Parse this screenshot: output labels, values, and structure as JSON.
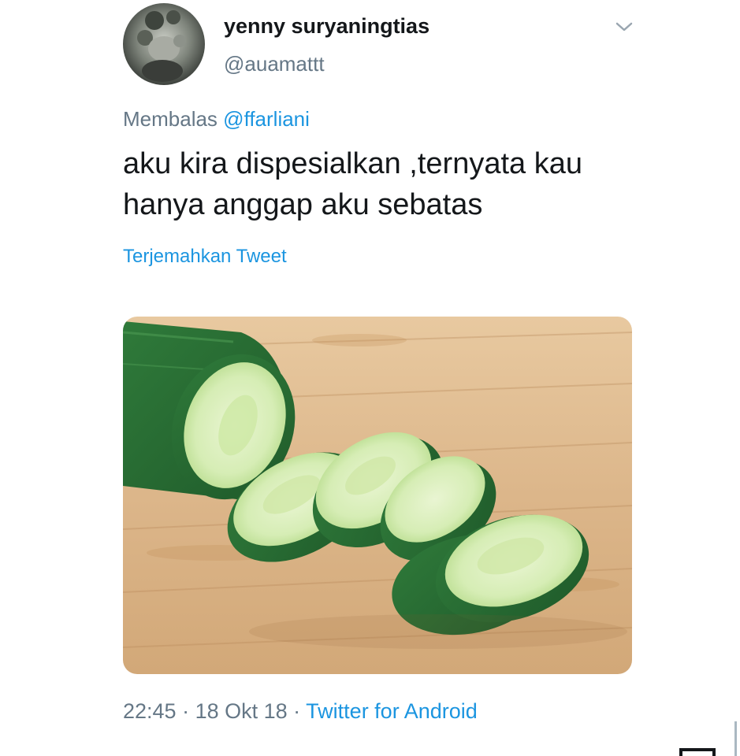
{
  "tweet": {
    "author": {
      "display_name": "yenny suryaningtias",
      "handle": "@auamattt",
      "avatar_icon": "profile-photo"
    },
    "reply": {
      "prefix": "Membalas",
      "mention": "@ffarliani"
    },
    "text": "aku kira dispesialkan ,ternyata kau hanya anggap aku sebatas",
    "translate_label": "Terjemahkan Tweet",
    "media": {
      "description_icon": "cucumber-slices-photo"
    },
    "meta": {
      "time": "22:45",
      "separator_1": " · ",
      "date": "18 Okt 18",
      "separator_2": " · ",
      "source": "Twitter for Android"
    }
  },
  "colors": {
    "text_primary": "#14171a",
    "text_secondary": "#657786",
    "link": "#1b95e0"
  }
}
